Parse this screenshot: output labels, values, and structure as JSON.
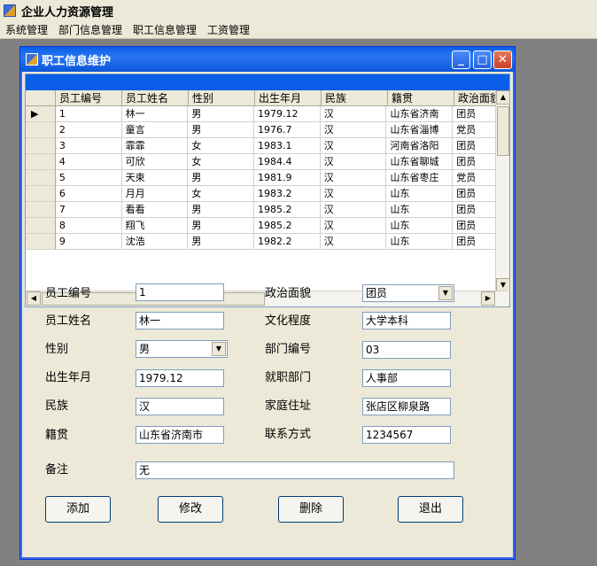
{
  "app": {
    "title": "企业人力资源管理"
  },
  "menu": [
    "系统管理",
    "部门信息管理",
    "职工信息管理",
    "工资管理"
  ],
  "window": {
    "title": "职工信息维护"
  },
  "grid": {
    "columns": [
      "员工编号",
      "员工姓名",
      "性别",
      "出生年月",
      "民族",
      "籍贯",
      "政治面貌"
    ],
    "current_row_marker": "▶",
    "rows": [
      [
        "1",
        "林一",
        "男",
        "1979.12",
        "汉",
        "山东省济南",
        "团员"
      ],
      [
        "2",
        "童言",
        "男",
        "1976.7",
        "汉",
        "山东省淄博",
        "党员"
      ],
      [
        "3",
        "霏霏",
        "女",
        "1983.1",
        "汉",
        "河南省洛阳",
        "团员"
      ],
      [
        "4",
        "可欣",
        "女",
        "1984.4",
        "汉",
        "山东省聊城",
        "团员"
      ],
      [
        "5",
        "天束",
        "男",
        "1981.9",
        "汉",
        "山东省枣庄",
        "党员"
      ],
      [
        "6",
        "月月",
        "女",
        "1983.2",
        "汉",
        "山东",
        "团员"
      ],
      [
        "7",
        "看看",
        "男",
        "1985.2",
        "汉",
        "山东",
        "团员"
      ],
      [
        "8",
        "翔飞",
        "男",
        "1985.2",
        "汉",
        "山东",
        "团员"
      ],
      [
        "9",
        "沈浩",
        "男",
        "1982.2",
        "汉",
        "山东",
        "团员"
      ]
    ]
  },
  "form": {
    "labels": {
      "emp_id": "员工编号",
      "emp_name": "员工姓名",
      "gender": "性别",
      "birth": "出生年月",
      "ethnicity": "民族",
      "origin": "籍贯",
      "politics": "政治面貌",
      "education": "文化程度",
      "dept_id": "部门编号",
      "dept": "就职部门",
      "address": "家庭住址",
      "contact": "联系方式",
      "remark": "备注"
    },
    "values": {
      "emp_id": "1",
      "emp_name": "林一",
      "gender": "男",
      "birth": "1979.12",
      "ethnicity": "汉",
      "origin": "山东省济南市",
      "politics": "团员",
      "education": "大学本科",
      "dept_id": "03",
      "dept": "人事部",
      "address": "张店区柳泉路",
      "contact": "1234567",
      "remark": "无"
    }
  },
  "buttons": {
    "add": "添加",
    "edit": "修改",
    "delete": "删除",
    "exit": "退出"
  },
  "colors": {
    "titlebar": "#0a5ee8",
    "face": "#ece9d8",
    "desktop": "#808080"
  }
}
